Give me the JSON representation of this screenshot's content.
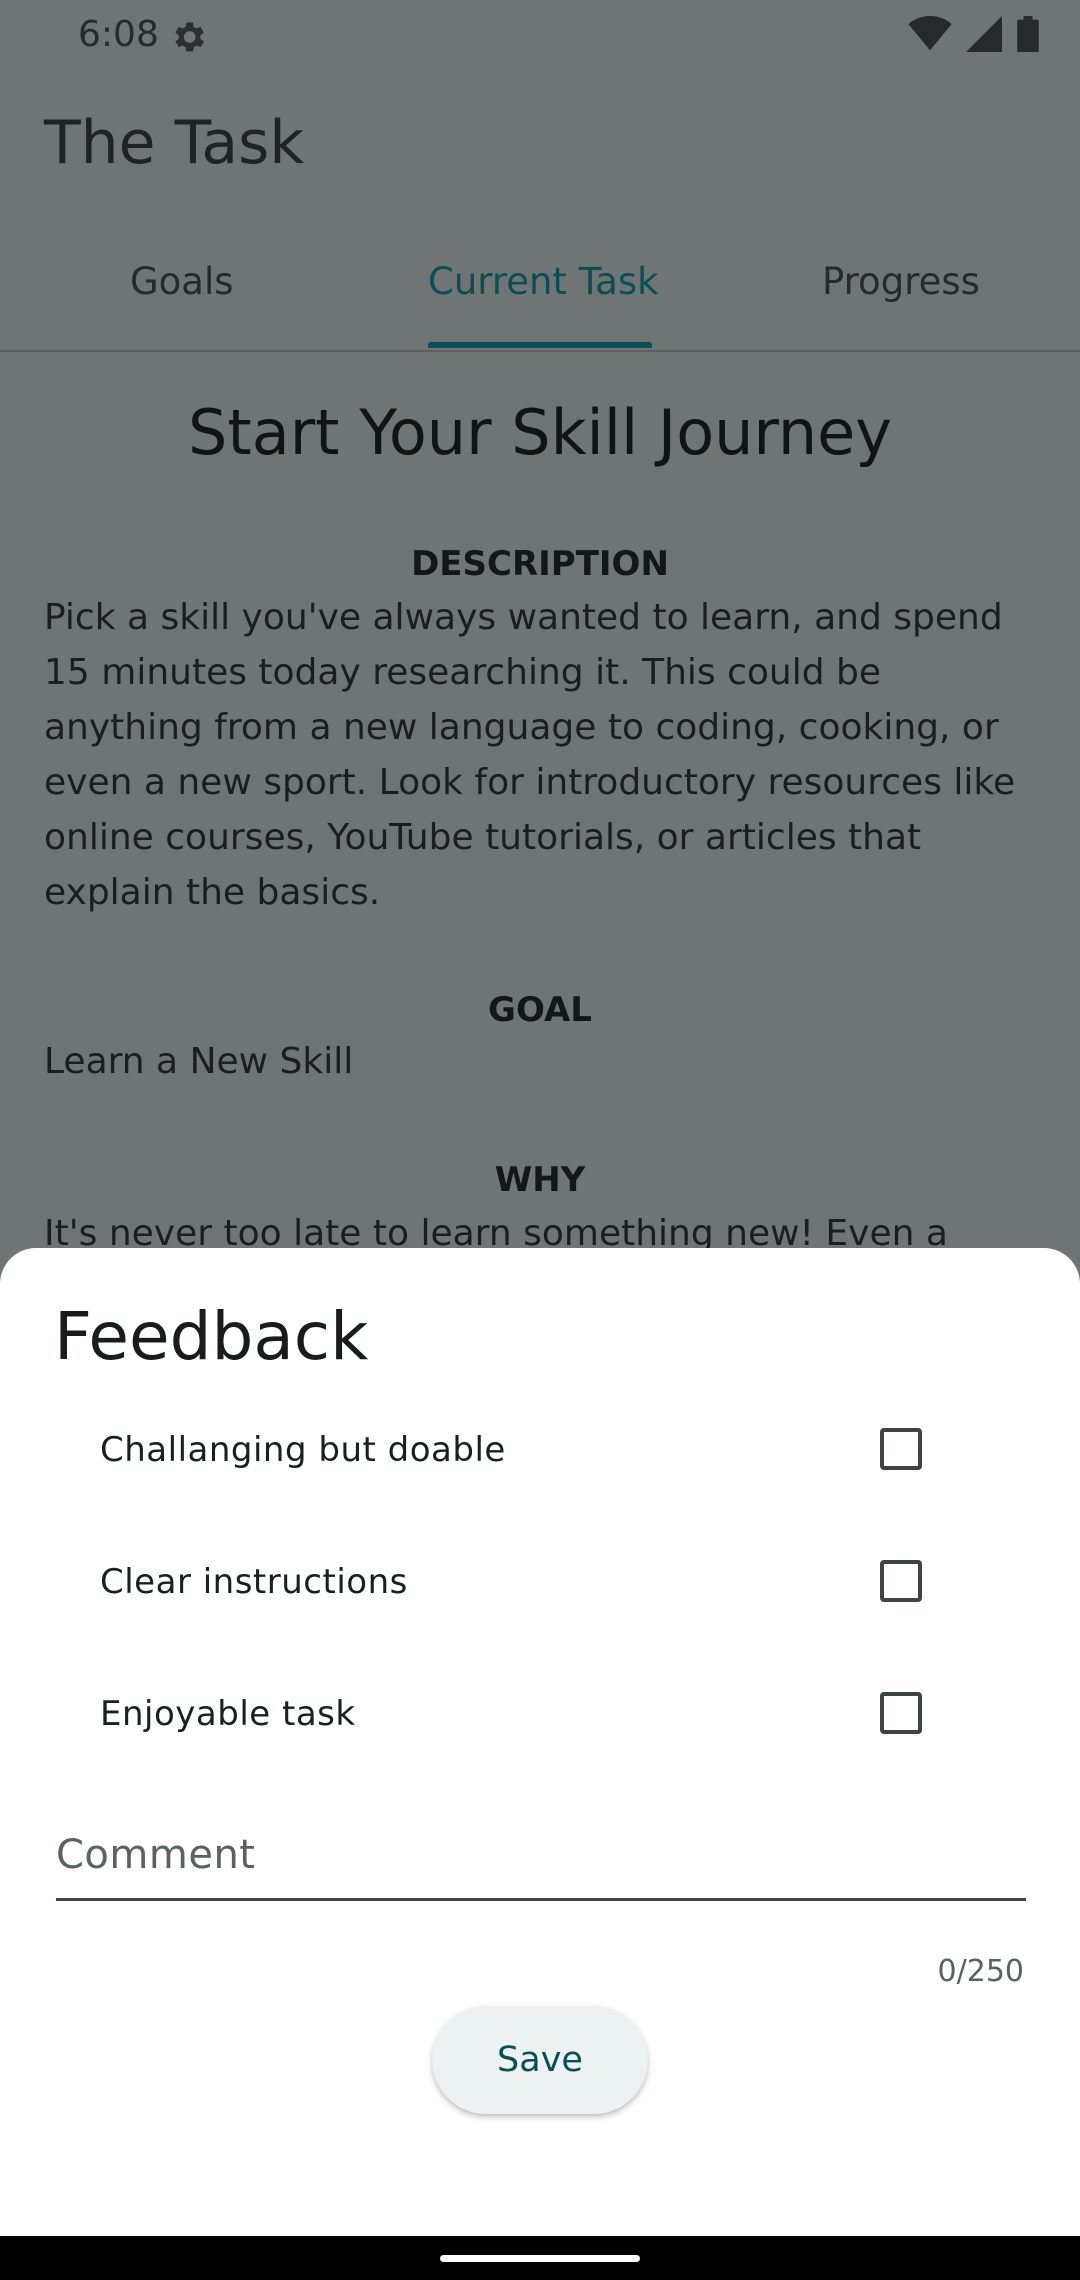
{
  "status_bar": {
    "time": "6:08"
  },
  "app": {
    "title": "The Task"
  },
  "tabs": [
    {
      "label": "Goals"
    },
    {
      "label": "Current Task"
    },
    {
      "label": "Progress"
    }
  ],
  "task": {
    "headline": "Start Your Skill Journey",
    "description_label": "DESCRIPTION",
    "description": "Pick a skill you've always wanted to learn, and spend 15 minutes today researching it. This could be anything from a new language to coding, cooking, or even a new sport.  Look for introductory resources like online courses, YouTube tutorials, or articles that explain the basics.",
    "goal_label": "GOAL",
    "goal": "Learn a New Skill",
    "why_label": "WHY",
    "why": "It's never too late to learn something new!  Even a"
  },
  "feedback": {
    "title": "Feedback",
    "options": [
      {
        "label": "Challanging but doable",
        "checked": false
      },
      {
        "label": "Clear instructions",
        "checked": false
      },
      {
        "label": "Enjoyable task",
        "checked": false
      }
    ],
    "comment_label": "Comment",
    "comment_value": "",
    "counter": "0/250",
    "save_label": "Save"
  },
  "colors": {
    "accent": "#0b4f55",
    "scrim_background": "#6f7474",
    "sheet_background": "#ffffff",
    "button_background": "#ecf2f1"
  },
  "icons": [
    "settings-gear-icon",
    "wifi-icon",
    "cell-signal-icon",
    "battery-icon"
  ]
}
